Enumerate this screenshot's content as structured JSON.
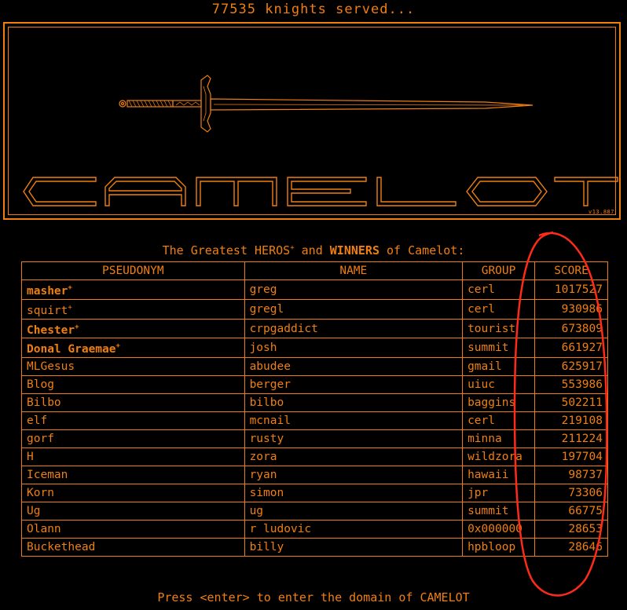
{
  "header": {
    "counter_text": "77535 knights served..."
  },
  "banner": {
    "title": "CAMELOT",
    "version": "v13.887"
  },
  "leaderboard": {
    "heading_prefix": "The Greatest ",
    "heading_heros": "HEROS",
    "heading_and": " and ",
    "heading_winners": "WINNERS",
    "heading_suffix": " of Camelot:",
    "hero_mark": "+",
    "columns": [
      "PSEUDONYM",
      "NAME",
      "GROUP",
      "SCORE"
    ],
    "rows": [
      {
        "pseudonym": "masher",
        "hero": true,
        "winner": true,
        "name": "greg",
        "group": "cerl",
        "score": "1017527"
      },
      {
        "pseudonym": "squirt",
        "hero": true,
        "winner": false,
        "name": "gregl",
        "group": "cerl",
        "score": "930986"
      },
      {
        "pseudonym": "Chester",
        "hero": true,
        "winner": true,
        "name": "crpgaddict",
        "group": "tourist",
        "score": "673809"
      },
      {
        "pseudonym": "Donal Graemae",
        "hero": true,
        "winner": true,
        "name": "josh",
        "group": "summit",
        "score": "661927"
      },
      {
        "pseudonym": "MLGesus",
        "hero": false,
        "winner": false,
        "name": "abudee",
        "group": "gmail",
        "score": "625917"
      },
      {
        "pseudonym": "Blog",
        "hero": false,
        "winner": false,
        "name": "berger",
        "group": "uiuc",
        "score": "553986"
      },
      {
        "pseudonym": "Bilbo",
        "hero": false,
        "winner": false,
        "name": "bilbo",
        "group": "baggins",
        "score": "502211"
      },
      {
        "pseudonym": "elf",
        "hero": false,
        "winner": false,
        "name": "mcnail",
        "group": "cerl",
        "score": "219108"
      },
      {
        "pseudonym": "gorf",
        "hero": false,
        "winner": false,
        "name": "rusty",
        "group": "minna",
        "score": "211224"
      },
      {
        "pseudonym": "H",
        "hero": false,
        "winner": false,
        "name": "zora",
        "group": "wildzora",
        "score": "197704"
      },
      {
        "pseudonym": "Iceman",
        "hero": false,
        "winner": false,
        "name": "ryan",
        "group": "hawaii",
        "score": "98737"
      },
      {
        "pseudonym": "Korn",
        "hero": false,
        "winner": false,
        "name": "simon",
        "group": "jpr",
        "score": "73306"
      },
      {
        "pseudonym": "Ug",
        "hero": false,
        "winner": false,
        "name": "ug",
        "group": "summit",
        "score": "66775"
      },
      {
        "pseudonym": "Olann",
        "hero": false,
        "winner": false,
        "name": "r ludovic",
        "group": "0x000000",
        "score": "28653"
      },
      {
        "pseudonym": "Buckethead",
        "hero": false,
        "winner": false,
        "name": "billy",
        "group": "hpbloop",
        "score": "28646"
      }
    ]
  },
  "footer": {
    "prompt": "Press <enter> to enter the domain of CAMELOT"
  },
  "colors": {
    "accent": "#f07f10",
    "background": "#000000",
    "annotation": "#ff2a1a"
  }
}
